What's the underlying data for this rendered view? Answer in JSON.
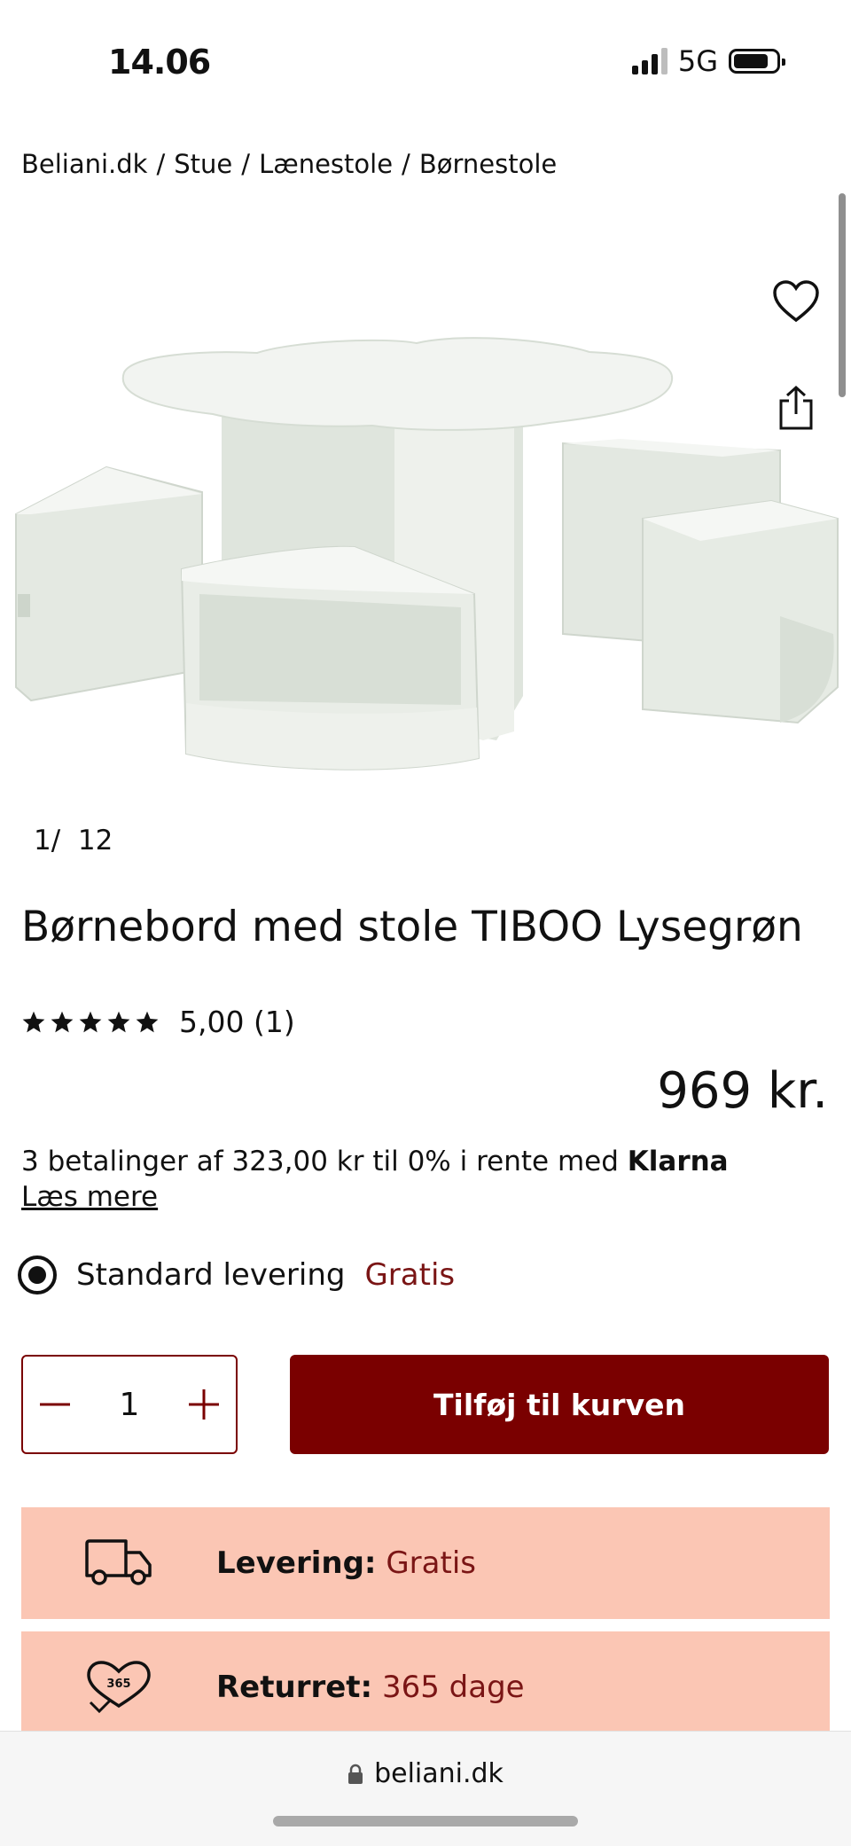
{
  "status_bar": {
    "time": "14.06",
    "network": "5G",
    "icons": [
      "signal-icon",
      "battery-icon"
    ]
  },
  "breadcrumb": [
    "Beliani.dk",
    "Stue",
    "Lænestole",
    "Børnestole"
  ],
  "breadcrumb_separator": "/",
  "gallery": {
    "current": "1/",
    "total": "12",
    "image": "product-image-children-table-with-stools"
  },
  "product": {
    "title": "Børnebord med stole TIBOO Lysegrøn",
    "rating": {
      "stars": 5,
      "label": "5,00 (1)"
    },
    "price": "969 kr."
  },
  "klarna": {
    "text": "3 betalinger af 323,00 kr til 0% i rente med ",
    "brand": "Klarna",
    "read_more": "Læs mere"
  },
  "delivery_option": {
    "label": "Standard levering",
    "price": "Gratis"
  },
  "quantity": {
    "value": "1",
    "minus": "−",
    "plus": "+"
  },
  "add_to_cart": "Tilføj til kurven",
  "info_cards": [
    {
      "icon": "truck-icon",
      "label": "Levering:",
      "value": "Gratis"
    },
    {
      "icon": "heart-365-icon",
      "label": "Returret:",
      "value": "365 dage",
      "badge": "365"
    }
  ],
  "browser": {
    "url": "beliani.dk"
  },
  "colors": {
    "brand": "#7a0000",
    "accent_text": "#7a1515",
    "info_bg": "#fbc6b4"
  }
}
